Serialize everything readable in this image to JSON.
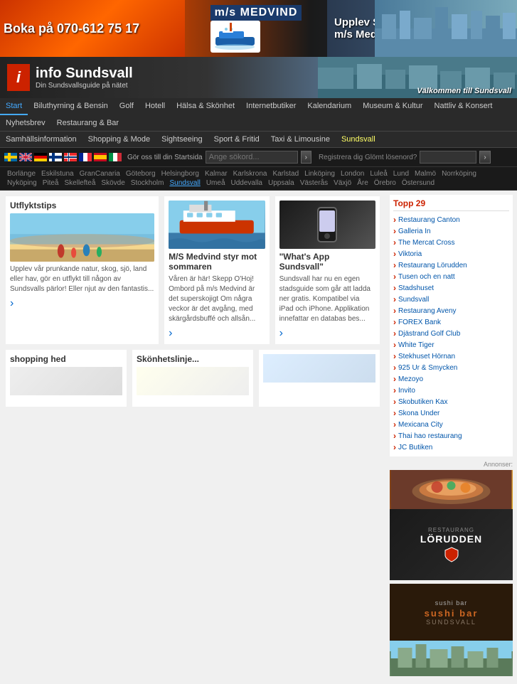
{
  "header": {
    "phone": "Boka på 070-612 75 17",
    "brand": "m/s MEDVIND",
    "slogan": "Upplev Sundsvalls skärgård från\nm/s Medvind!",
    "info_title": "info Sundsvall",
    "info_subtitle": "Din Sundsvallsguide på nätet",
    "cityscape_text": "Välkommen till Sundsvall"
  },
  "nav": {
    "row1": [
      "Start",
      "Biluthyrning & Bensin",
      "Golf",
      "Hotell",
      "Hälsa & Skönhet",
      "Internetbutiker",
      "Kalendarium",
      "Museum & Kultur",
      "Nattliv & Konsert",
      "Nyhetsbrev",
      "Restaurang & Bar"
    ],
    "row2": [
      "Samhällsinformation",
      "Shopping & Mode",
      "Sightseeing",
      "Sport & Fritid",
      "Taxi & Limousine",
      "Sundsvall"
    ]
  },
  "search": {
    "go_start": "Gör oss till din Startsida",
    "placeholder": "Ange sökord...",
    "search_btn": "›",
    "register_text": "Registrera dig Glömt lösenord?"
  },
  "cities": [
    "Borlänge",
    "Eskilstuna",
    "GranCanaria",
    "Göteborg",
    "Helsingborg",
    "Kalmar",
    "Karlskrona",
    "Karlstad",
    "Linköping",
    "London",
    "Luleå",
    "Lund",
    "Malmö",
    "Norrköping",
    "Nyköping",
    "Piteå",
    "Skellefteå",
    "Skövde",
    "Stockholm",
    "Sundsvall",
    "Umeå",
    "Uddevalla",
    "Uppsala",
    "Västerås",
    "Växjö",
    "Åre",
    "Örebro",
    "Östersund"
  ],
  "articles": {
    "utflyktstips": {
      "title": "Utflyktstips",
      "body": "Upplev vår prunkande natur, skog, sjö, land eller hav, gör en utflykt till någon av Sundsvalls pärlor! Eller njut av den fantastis...",
      "more": "›"
    },
    "medvind": {
      "title": "M/S Medvind styr mot sommaren",
      "body": "Våren är här! Skepp O'Hoj! Ombord på m/s Medvind är det superskojigt Om några veckor är det avgång, med skärgårdsbuffé och allsån...",
      "more": "›"
    },
    "whatsapp": {
      "title": "\"What's App Sundsvall\"",
      "body": "Sundsvall har nu en egen stadsguide som går att ladda ner gratis. Kompatibel via iPad och iPhone. Applikation innefattar en databas bes...",
      "more": "›"
    },
    "shopping": {
      "title": "shopping hed",
      "body": ""
    },
    "skonspa": {
      "title": "Skönhetslinje...",
      "body": ""
    }
  },
  "tipp29": {
    "title": "Topp 29",
    "items": [
      "Restaurang Canton",
      "Galleria In",
      "The Mercat Cross",
      "Viktoria",
      "Restaurang Lörudden",
      "Tusen och en natt",
      "Stadshuset",
      "Sundsvall",
      "Restaurang Aveny",
      "FOREX Bank",
      "Djästrand Golf Club",
      "White Tiger",
      "Stekhuset Hörnan",
      "925 Ur & Smycken",
      "Mezoyo",
      "Invito",
      "Skobutiken Kax",
      "Skona Under",
      "Mexicana City",
      "Thai hao restaurang",
      "JC Butiken"
    ]
  },
  "ads": {
    "annons": "Annonser:",
    "lorudden_name": "RESTAURANG",
    "lorudden_sub": "LÖRUDDEN",
    "sushi_name": "sushi bar",
    "sushi_location": "SUNDSVALL"
  }
}
